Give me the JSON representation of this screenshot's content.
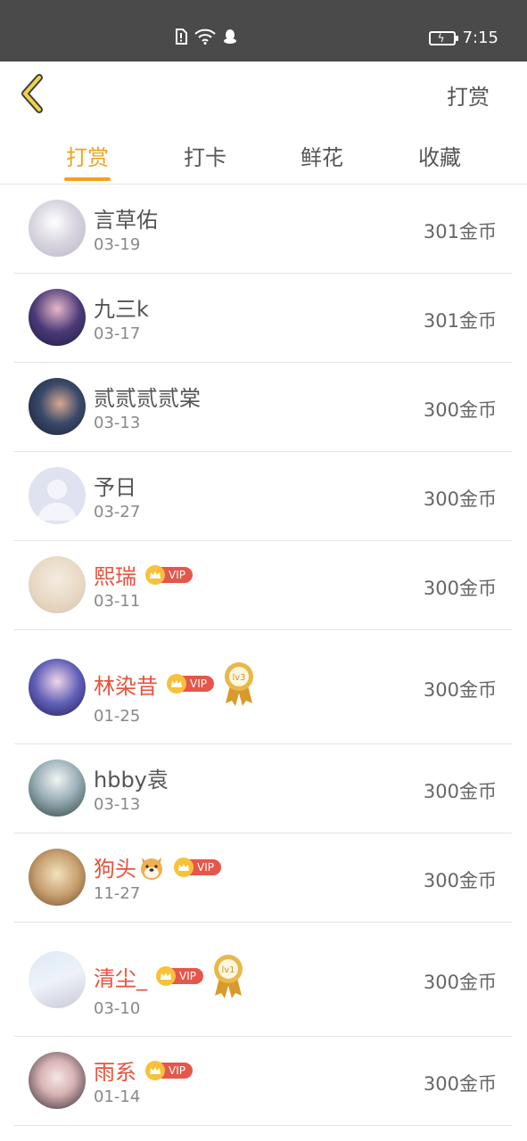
{
  "status_bar": {
    "time": "7:15"
  },
  "header": {
    "back_icon": "chevron-left-icon",
    "action_label": "打赏"
  },
  "tabs": [
    {
      "label": "打赏",
      "active": true
    },
    {
      "label": "打卡",
      "active": false
    },
    {
      "label": "鲜花",
      "active": false
    },
    {
      "label": "收藏",
      "active": false
    }
  ],
  "colors": {
    "accent": "#f2a21a",
    "vip_name": "#e8523c",
    "vip_badge": "#e6564a",
    "crown": "#f7c23a"
  },
  "vip_label": "VIP",
  "rewards": [
    {
      "name": "言草佑",
      "date": "03-19",
      "amount": "301金币",
      "vip": false
    },
    {
      "name": "九三k",
      "date": "03-17",
      "amount": "301金币",
      "vip": false
    },
    {
      "name": "贰贰贰贰棠",
      "date": "03-13",
      "amount": "300金币",
      "vip": false
    },
    {
      "name": "予日",
      "date": "03-27",
      "amount": "300金币",
      "vip": false,
      "default_avatar": true
    },
    {
      "name": "熙瑞",
      "date": "03-11",
      "amount": "300金币",
      "vip": true
    },
    {
      "name": "林染昔",
      "date": "01-25",
      "amount": "300金币",
      "vip": true,
      "medal": "lv3"
    },
    {
      "name": "hbby袁",
      "date": "03-13",
      "amount": "300金币",
      "vip": false
    },
    {
      "name": "狗头",
      "date": "11-27",
      "amount": "300金币",
      "vip": true,
      "emoji": "dog-face"
    },
    {
      "name": "清尘_",
      "date": "03-10",
      "amount": "300金币",
      "vip": true,
      "medal": "lv1"
    },
    {
      "name": "雨系",
      "date": "01-14",
      "amount": "300金币",
      "vip": true
    }
  ]
}
